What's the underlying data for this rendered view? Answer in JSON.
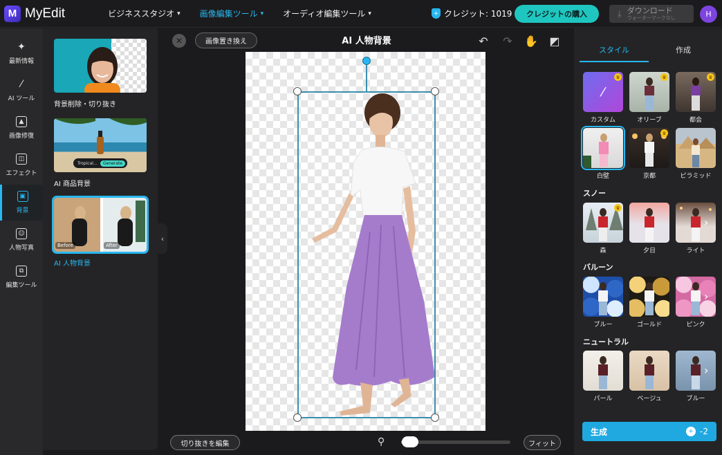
{
  "app": {
    "name": "MyEdit",
    "logo_letter": "M"
  },
  "nav": [
    {
      "label": "ビジネススタジオ",
      "active": false
    },
    {
      "label": "画像編集ツール",
      "active": true
    },
    {
      "label": "オーディオ編集ツール",
      "active": false
    }
  ],
  "credits": {
    "label": "クレジット: 1019",
    "buy_label": "クレジットの購入"
  },
  "download": {
    "label": "ダウンロード",
    "sub": "ウォーターマークなし"
  },
  "user": {
    "initial": "H"
  },
  "rail": [
    {
      "label": "最新情報",
      "icon": "sparkle-icon"
    },
    {
      "label": "AI ツール",
      "icon": "magic-wand-icon"
    },
    {
      "label": "画像修復",
      "icon": "image-repair-icon"
    },
    {
      "label": "エフェクト",
      "icon": "effect-icon"
    },
    {
      "label": "背景",
      "icon": "background-icon",
      "active": true
    },
    {
      "label": "人物写真",
      "icon": "portrait-icon"
    },
    {
      "label": "編集ツール",
      "icon": "edit-tools-icon"
    }
  ],
  "tools": [
    {
      "label": "背景削除・切り抜き"
    },
    {
      "label": "AI 商品背景",
      "product_tag": "Tropical…",
      "product_button": "Generate"
    },
    {
      "label": "AI 人物背景",
      "active": true,
      "before": "Before",
      "after": "After"
    }
  ],
  "canvas": {
    "replace_label": "画像置き換え",
    "title": "AI 人物背景",
    "edit_cutout_label": "切り抜きを編集",
    "fit_label": "フィット",
    "zoom_percent": 8
  },
  "right_panel": {
    "tabs": [
      {
        "label": "スタイル",
        "active": true
      },
      {
        "label": "作成",
        "active": false
      }
    ],
    "rows": [
      {
        "title": "",
        "items": [
          {
            "label": "カスタム",
            "premium": true
          },
          {
            "label": "オリーブ",
            "premium": true
          },
          {
            "label": "都会",
            "premium": true
          }
        ]
      },
      {
        "title": "",
        "items": [
          {
            "label": "白壁",
            "selected": true
          },
          {
            "label": "京都",
            "premium": true
          },
          {
            "label": "ピラミッド"
          }
        ]
      },
      {
        "title": "スノー",
        "items": [
          {
            "label": "森",
            "premium": true
          },
          {
            "label": "夕日"
          },
          {
            "label": "ライト"
          }
        ]
      },
      {
        "title": "バルーン",
        "items": [
          {
            "label": "ブルー"
          },
          {
            "label": "ゴールド"
          },
          {
            "label": "ピンク"
          }
        ]
      },
      {
        "title": "ニュートラル",
        "items": [
          {
            "label": "パール"
          },
          {
            "label": "ベージュ"
          },
          {
            "label": "ブルー"
          }
        ]
      }
    ],
    "generate_label": "生成",
    "generate_cost": "-2"
  },
  "colors": {
    "accent": "#28b7f0",
    "teal": "#1fc6c0",
    "canvas_bg": "#1b1b1d"
  }
}
